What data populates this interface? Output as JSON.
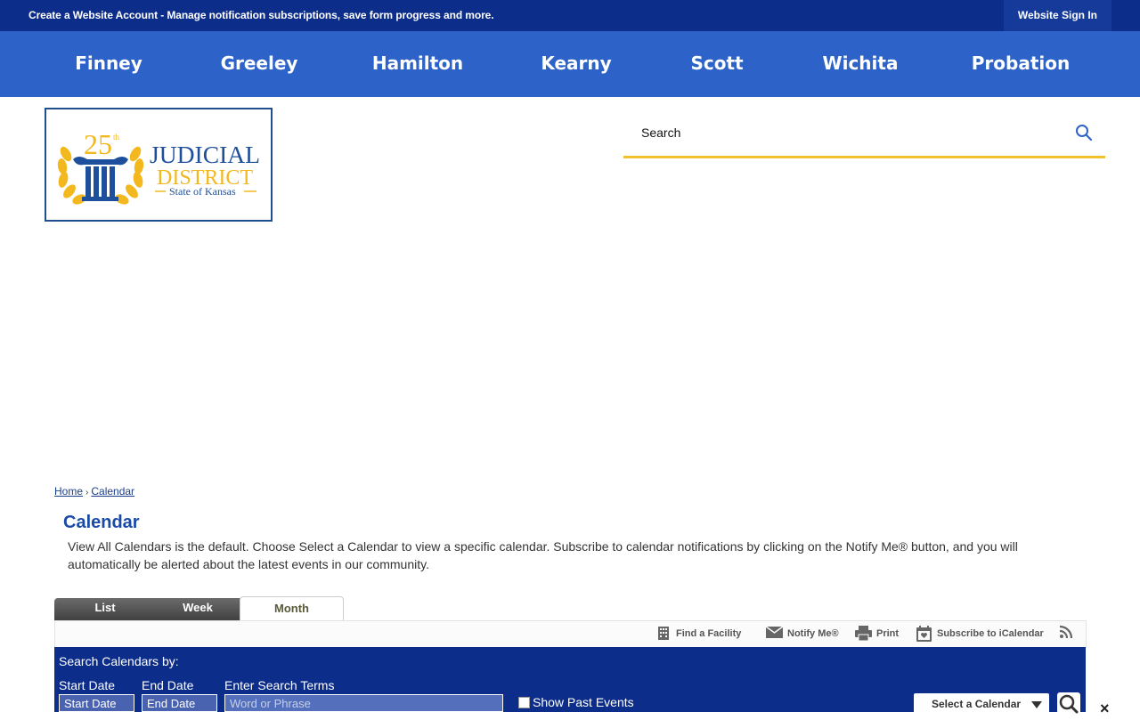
{
  "topbar": {
    "account_link": "Create a Website Account",
    "account_text": " - Manage notification subscriptions, save form progress and more.",
    "signin_label": "Website Sign In"
  },
  "nav": {
    "items": [
      {
        "label": "Finney"
      },
      {
        "label": "Greeley"
      },
      {
        "label": "Hamilton"
      },
      {
        "label": "Kearny"
      },
      {
        "label": "Scott"
      },
      {
        "label": "Wichita"
      },
      {
        "label": "Probation"
      }
    ]
  },
  "logo": {
    "number": "25",
    "suffix": "th",
    "line1": "JUDICIAL",
    "line2": "DISTRICT",
    "line3": "State of Kansas"
  },
  "search": {
    "placeholder": "Search",
    "icon": "search-icon"
  },
  "breadcrumb": {
    "home": "Home",
    "sep": "›",
    "current": "Calendar"
  },
  "page": {
    "title": "Calendar",
    "description": "View All Calendars is the default. Choose Select a Calendar to view a specific calendar. Subscribe to calendar notifications by clicking on the Notify Me® button, and you will automatically be alerted about the latest events in our community."
  },
  "tabs": [
    {
      "label": "List"
    },
    {
      "label": "Week"
    },
    {
      "label": "Month",
      "active": true
    }
  ],
  "toolbar": {
    "find_facility": "Find a Facility",
    "notify_me": "Notify Me®",
    "print": "Print",
    "subscribe": "Subscribe to iCalendar"
  },
  "search_panel": {
    "heading": "Search Calendars by:",
    "start_label": "Start Date",
    "end_label": "End Date",
    "terms_label": "Enter Search Terms",
    "start_value": "Start Date",
    "end_value": "End Date",
    "terms_placeholder": "Word or Phrase",
    "past_events": "Show Past Events",
    "select_calendar": "Select a Calendar"
  },
  "colors": {
    "topbar": "#0c2d8a",
    "nav": "#2d63c8",
    "accent_gold": "#f2c12e",
    "title_blue": "#1a4aa8"
  }
}
